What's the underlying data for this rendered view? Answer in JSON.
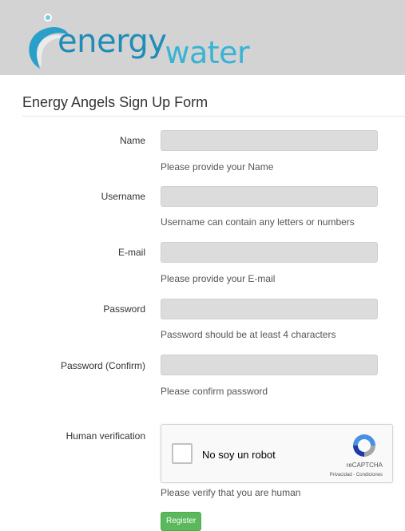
{
  "brand": {
    "logo_primary": "energy",
    "logo_secondary": "water"
  },
  "form": {
    "title": "Energy Angels Sign Up Form",
    "fields": [
      {
        "label": "Name",
        "value": "",
        "help": "Please provide your Name"
      },
      {
        "label": "Username",
        "value": "",
        "help": "Username can contain any letters or numbers"
      },
      {
        "label": "E-mail",
        "value": "",
        "help": "Please provide your E-mail"
      },
      {
        "label": "Password",
        "value": "",
        "help": "Password should be at least 4 characters"
      },
      {
        "label": "Password (Confirm)",
        "value": "",
        "help": "Please confirm password"
      }
    ],
    "verification": {
      "label": "Human verification",
      "checkbox_text": "No soy un robot",
      "captcha_brand": "reCAPTCHA",
      "captcha_links": "Privacidad - Condiciones",
      "help": "Please verify that you are human",
      "checked": false
    },
    "submit_label": "Register"
  },
  "colors": {
    "header_bg": "#d3d3d3",
    "logo_blue": "#1f8cb8",
    "logo_light_blue": "#37b3d6",
    "input_bg": "#dcdcdc",
    "register_green": "#5cb85c"
  }
}
